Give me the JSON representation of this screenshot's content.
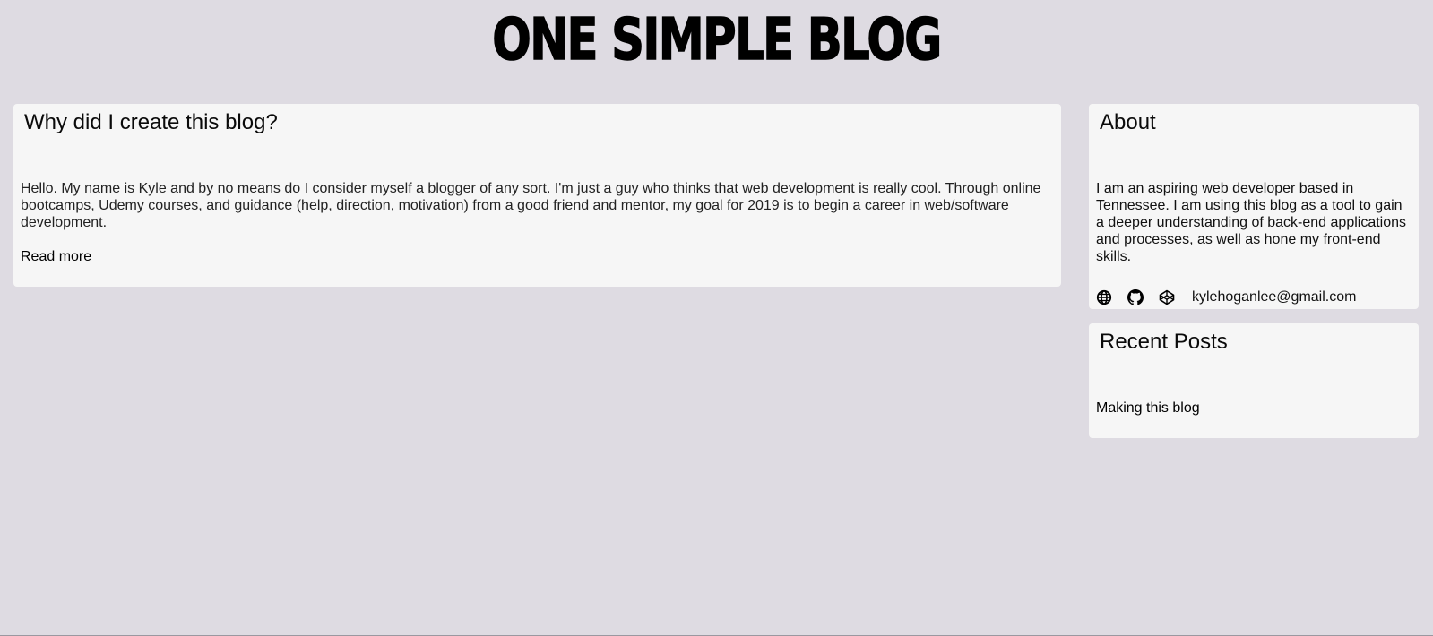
{
  "site": {
    "title": "ONE SIMPLE BLOG"
  },
  "post": {
    "title": "Why did I create this blog?",
    "excerpt": "Hello. My name is Kyle and by no means do I consider myself a blogger of any sort. I'm just a guy who thinks that web development is really cool. Through online bootcamps, Udemy courses, and guidance (help, direction, motivation) from a good friend and mentor, my goal for 2019 is to begin a career in web/software development.",
    "read_more_label": "Read more"
  },
  "about": {
    "heading": "About",
    "text": "I am an aspiring web developer based in Tennessee. I am using this blog as a tool to gain a deeper understanding of back-end applications and processes, as well as hone my front-end skills.",
    "social_icons": [
      "globe-icon",
      "github-icon",
      "codepen-icon"
    ],
    "email": "kylehoganlee@gmail.com"
  },
  "recent": {
    "heading": "Recent Posts",
    "items": [
      {
        "label": "Making this blog"
      }
    ]
  },
  "colors": {
    "background": "#dedbe2",
    "card": "#f6f6f6",
    "text": "#111111"
  }
}
